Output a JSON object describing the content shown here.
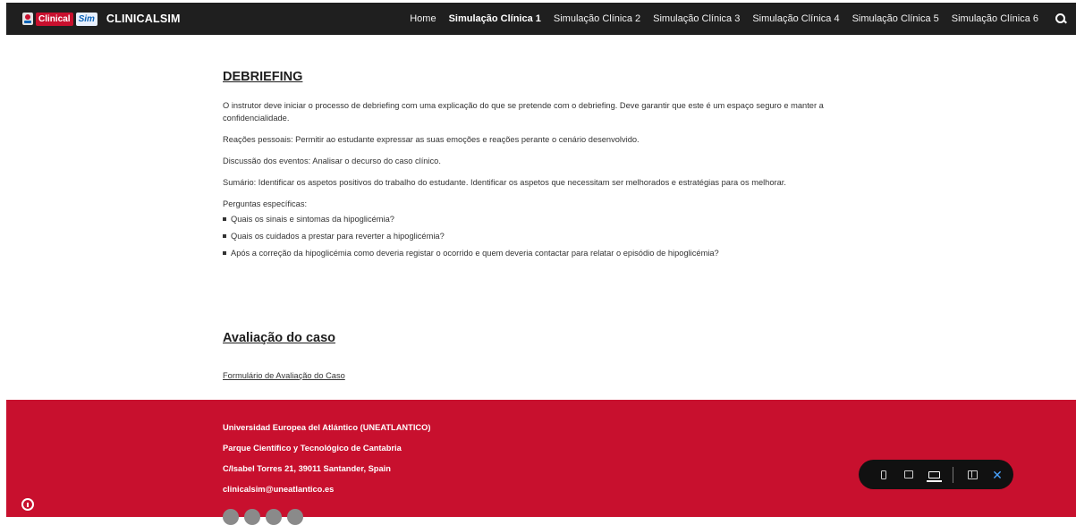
{
  "header": {
    "logo_text_1": "Clinical",
    "logo_text_2": "Sim",
    "brand": "CLINICALSIM",
    "nav": [
      {
        "label": "Home",
        "active": false
      },
      {
        "label": "Simulação Clínica 1",
        "active": true
      },
      {
        "label": "Simulação Clínica 2",
        "active": false
      },
      {
        "label": "Simulação Clínica 3",
        "active": false
      },
      {
        "label": "Simulação Clínica 4",
        "active": false
      },
      {
        "label": "Simulação Clínica 5",
        "active": false
      },
      {
        "label": "Simulação Clínica 6",
        "active": false
      }
    ],
    "search_icon": "search-icon"
  },
  "debriefing": {
    "title": "DEBRIEFING",
    "intro": "O instrutor deve iniciar o processo de debriefing com uma explicação do que se pretende com o debriefing. Deve garantir que este é um espaço seguro e manter a confidencialidade.",
    "reactions": "Reações pessoais: Permitir ao estudante expressar as suas emoções e reações perante o cenário desenvolvido.",
    "discussion": "Discussão dos eventos: Analisar o decurso do caso clínico.",
    "summary": "Sumário: Identificar os aspetos positivos do trabalho do estudante. Identificar os aspetos que necessitam ser melhorados e estratégias para os melhorar.",
    "questions_intro": "Perguntas específicas:",
    "questions": [
      "Quais os sinais e sintomas da hipoglicémia?",
      "Quais os cuidados a prestar para reverter a hipoglicémia?",
      "Após a correção da hipoglicémia como deveria registar o ocorrido e quem deveria contactar para relatar o episódio de hipoglicémia?"
    ]
  },
  "evaluation": {
    "title": "Avaliação do caso",
    "link": "Formulário de Avaliação do Caso"
  },
  "footer": {
    "lines": [
      "Universidad Europea del Atlántico (UNEATLANTICO)",
      "Parque Científico y Tecnológico de Cantabria",
      "C/Isabel Torres 21, 39011 Santander, Spain",
      "clinicalsim@uneatlantico.es"
    ]
  },
  "device_bar": {
    "icons": [
      "mobile-icon",
      "tablet-icon",
      "desktop-icon",
      "feedback-icon",
      "close-icon"
    ],
    "close_label": "✕"
  },
  "colors": {
    "header_bg": "#1f1f1f",
    "footer_bg": "#c8102e",
    "device_bar_bg": "#111111",
    "close_accent": "#4aa3ff"
  }
}
